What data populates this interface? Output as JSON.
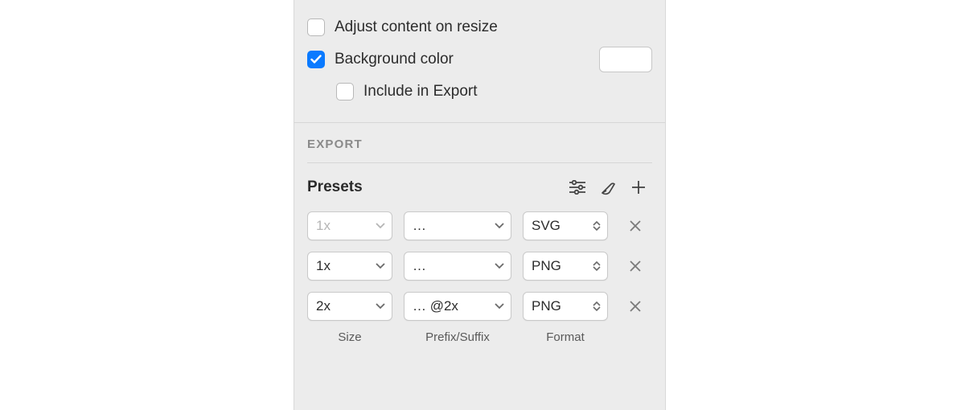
{
  "artboard": {
    "adjust_label": "Adjust content on resize",
    "adjust_checked": false,
    "bg_label": "Background color",
    "bg_checked": true,
    "bg_color": "#ffffff",
    "include_label": "Include in Export",
    "include_checked": false
  },
  "export": {
    "header": "EXPORT",
    "presets_title": "Presets",
    "columns": {
      "size": "Size",
      "prefix": "Prefix/Suffix",
      "format": "Format"
    },
    "rows": [
      {
        "size": "1x",
        "size_disabled": true,
        "prefix": "…",
        "format": "SVG"
      },
      {
        "size": "1x",
        "size_disabled": false,
        "prefix": "…",
        "format": "PNG"
      },
      {
        "size": "2x",
        "size_disabled": false,
        "prefix": "… @2x",
        "format": "PNG"
      }
    ]
  }
}
